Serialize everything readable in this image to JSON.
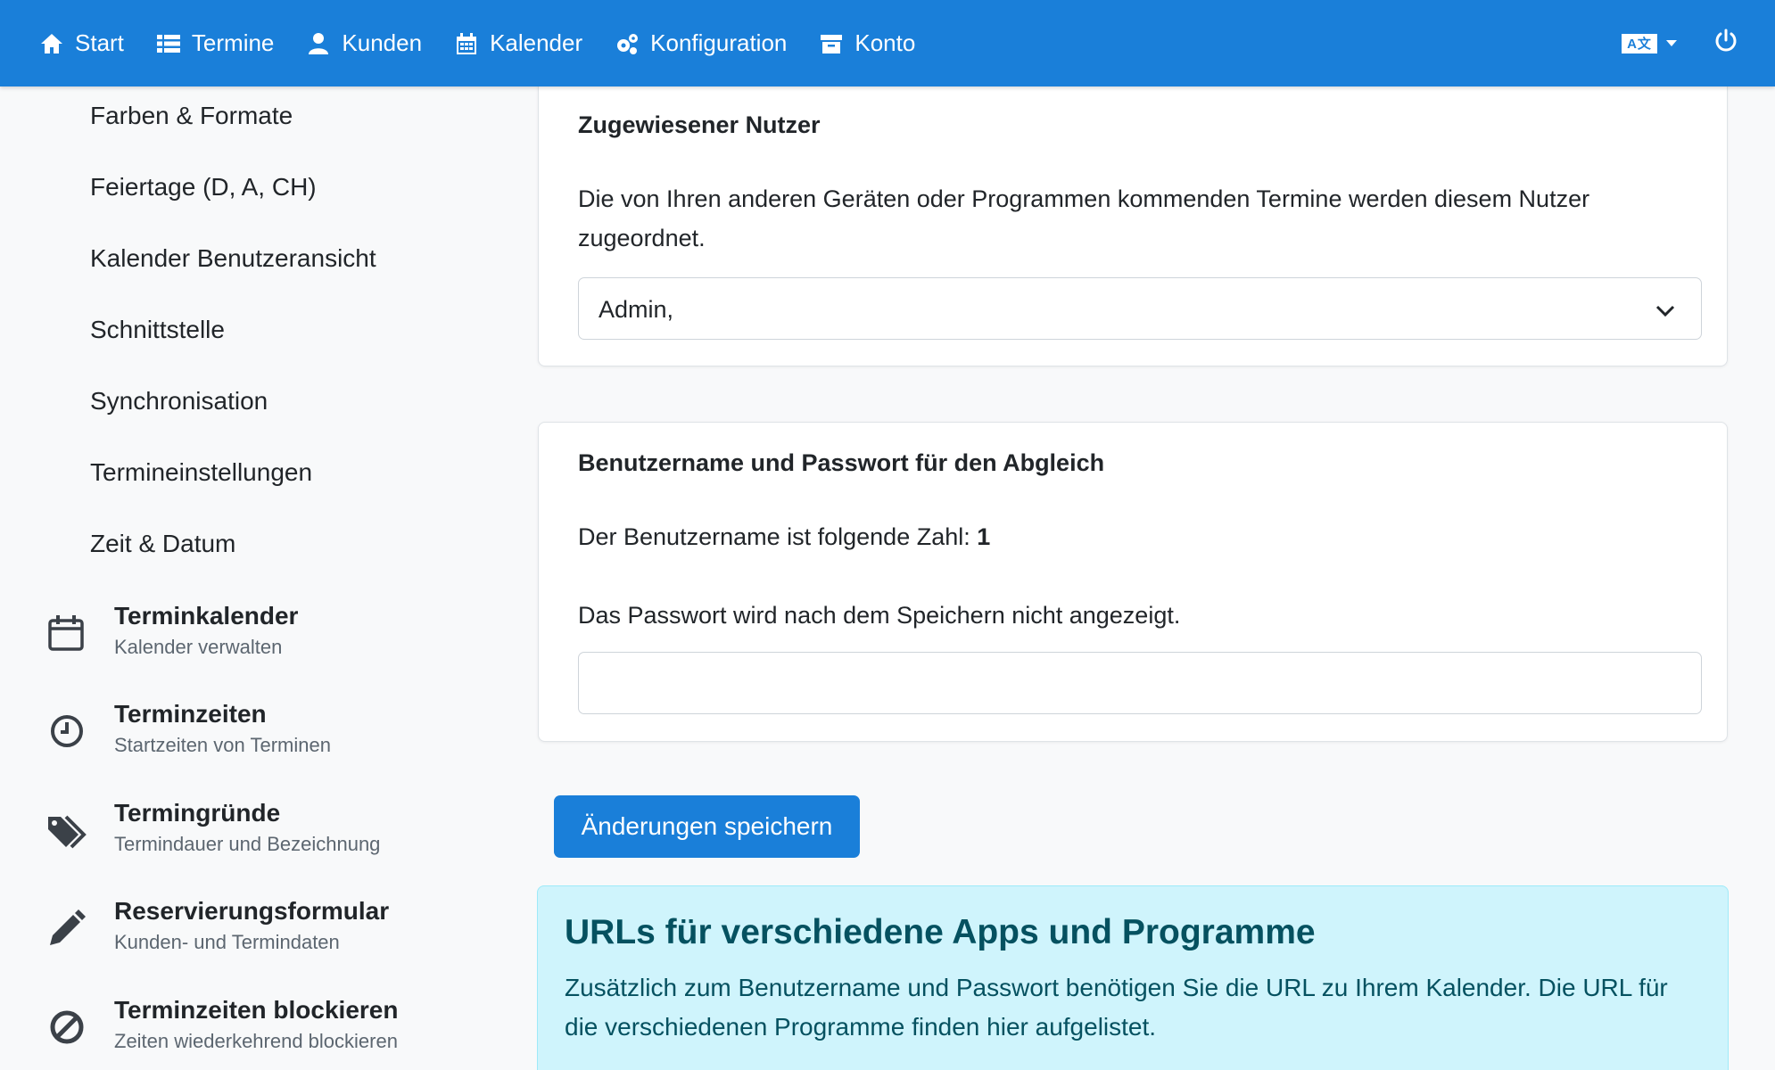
{
  "nav": {
    "items": [
      {
        "label": "Start",
        "icon": "home-icon"
      },
      {
        "label": "Termine",
        "icon": "list-icon"
      },
      {
        "label": "Kunden",
        "icon": "user-icon"
      },
      {
        "label": "Kalender",
        "icon": "calendar-icon"
      },
      {
        "label": "Konfiguration",
        "icon": "cogs-icon"
      },
      {
        "label": "Konto",
        "icon": "archive-icon"
      }
    ],
    "language_icon": "translate-icon",
    "language_glyph": "A文",
    "power_icon": "power-icon"
  },
  "sidebar": {
    "sub_items": [
      {
        "label": "Farben & Formate"
      },
      {
        "label": "Feiertage (D, A, CH)"
      },
      {
        "label": "Kalender Benutzeransicht"
      },
      {
        "label": "Schnittstelle"
      },
      {
        "label": "Synchronisation"
      },
      {
        "label": "Termineinstellungen"
      },
      {
        "label": "Zeit & Datum"
      }
    ],
    "main_items": [
      {
        "title": "Terminkalender",
        "subtitle": "Kalender verwalten",
        "icon": "calendar-icon"
      },
      {
        "title": "Terminzeiten",
        "subtitle": "Startzeiten von Terminen",
        "icon": "clock-icon"
      },
      {
        "title": "Termingründe",
        "subtitle": "Termindauer und Bezeichnung",
        "icon": "tags-icon"
      },
      {
        "title": "Reservierungsformular",
        "subtitle": "Kunden- und Termindaten",
        "icon": "pencil-icon"
      },
      {
        "title": "Terminzeiten blockieren",
        "subtitle": "Zeiten wiederkehrend blockieren",
        "icon": "ban-icon"
      }
    ]
  },
  "user_card": {
    "title": "Zugewiesener Nutzer",
    "text": "Die von Ihren anderen Geräten oder Programmen kommenden Termine werden diesem Nutzer zugeordnet.",
    "select_value": "Admin,"
  },
  "credentials_card": {
    "title": "Benutzername und Passwort für den Abgleich",
    "username_text": "Der Benutzername ist folgende Zahl: ",
    "username_value": "1",
    "password_text": "Das Passwort wird nach dem Speichern nicht angezeigt.",
    "password_value": ""
  },
  "save_button": {
    "label": "Änderungen speichern"
  },
  "info_card": {
    "title": "URLs für verschiedene Apps und Programme",
    "text": "Zusätzlich zum Benutzername und Passwort benötigen Sie die URL zu Ihrem Kalender. Die URL für die verschiedenen Programme finden hier aufgelistet."
  },
  "colors": {
    "primary": "#1a7fd9",
    "info_bg": "#cff4fc",
    "info_text": "#055160"
  }
}
